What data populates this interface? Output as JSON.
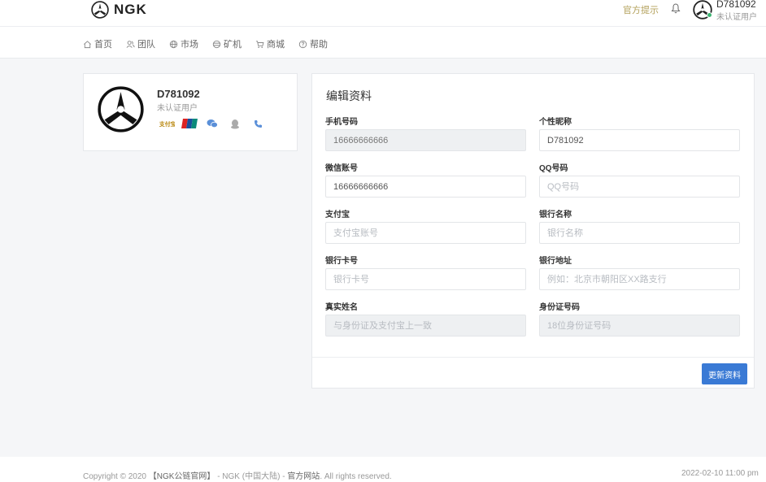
{
  "header": {
    "brand": "NGK",
    "notice": "官方提示",
    "user_name": "D781092",
    "user_status": "未认证用户"
  },
  "nav": [
    {
      "label": "首页",
      "icon": "home-icon"
    },
    {
      "label": "团队",
      "icon": "team-icon"
    },
    {
      "label": "市场",
      "icon": "globe-icon"
    },
    {
      "label": "矿机",
      "icon": "miner-icon"
    },
    {
      "label": "商城",
      "icon": "cart-icon"
    },
    {
      "label": "帮助",
      "icon": "help-icon"
    }
  ],
  "profile": {
    "name": "D781092",
    "status": "未认证用户",
    "icons": [
      "alipay-icon",
      "unionpay-icon",
      "wechat-icon",
      "qq-icon",
      "phone-icon"
    ],
    "alipay_text": "支付宝"
  },
  "edit": {
    "title": "编辑资料",
    "fields": {
      "phone": {
        "label": "手机号码",
        "value": "16666666666",
        "placeholder": ""
      },
      "nickname": {
        "label": "个性昵称",
        "value": "D781092",
        "placeholder": ""
      },
      "wechat": {
        "label": "微信账号",
        "value": "16666666666",
        "placeholder": ""
      },
      "qq": {
        "label": "QQ号码",
        "value": "",
        "placeholder": "QQ号码"
      },
      "alipay": {
        "label": "支付宝",
        "value": "",
        "placeholder": "支付宝账号"
      },
      "bank_name": {
        "label": "银行名称",
        "value": "",
        "placeholder": "银行名称"
      },
      "bank_card": {
        "label": "银行卡号",
        "value": "",
        "placeholder": "银行卡号"
      },
      "bank_address": {
        "label": "银行地址",
        "value": "",
        "placeholder": "例如：北京市朝阳区XX路支行"
      },
      "real_name": {
        "label": "真实姓名",
        "value": "",
        "placeholder": "与身份证及支付宝上一致"
      },
      "id_number": {
        "label": "身份证号码",
        "value": "",
        "placeholder": "18位身份证号码"
      }
    },
    "submit_label": "更新资料"
  },
  "footer": {
    "copyright_prefix": "Copyright © 2020",
    "site_name": "【NGK公链官网】",
    "middle": " - NGK (中国大陆) - ",
    "official": "官方网站",
    "suffix": ". All rights reserved.",
    "time": "2022-02-10 11:00 pm"
  },
  "colors": {
    "accent": "#3a7ad5",
    "notice": "#b3a05a",
    "online": "#3cb371"
  }
}
